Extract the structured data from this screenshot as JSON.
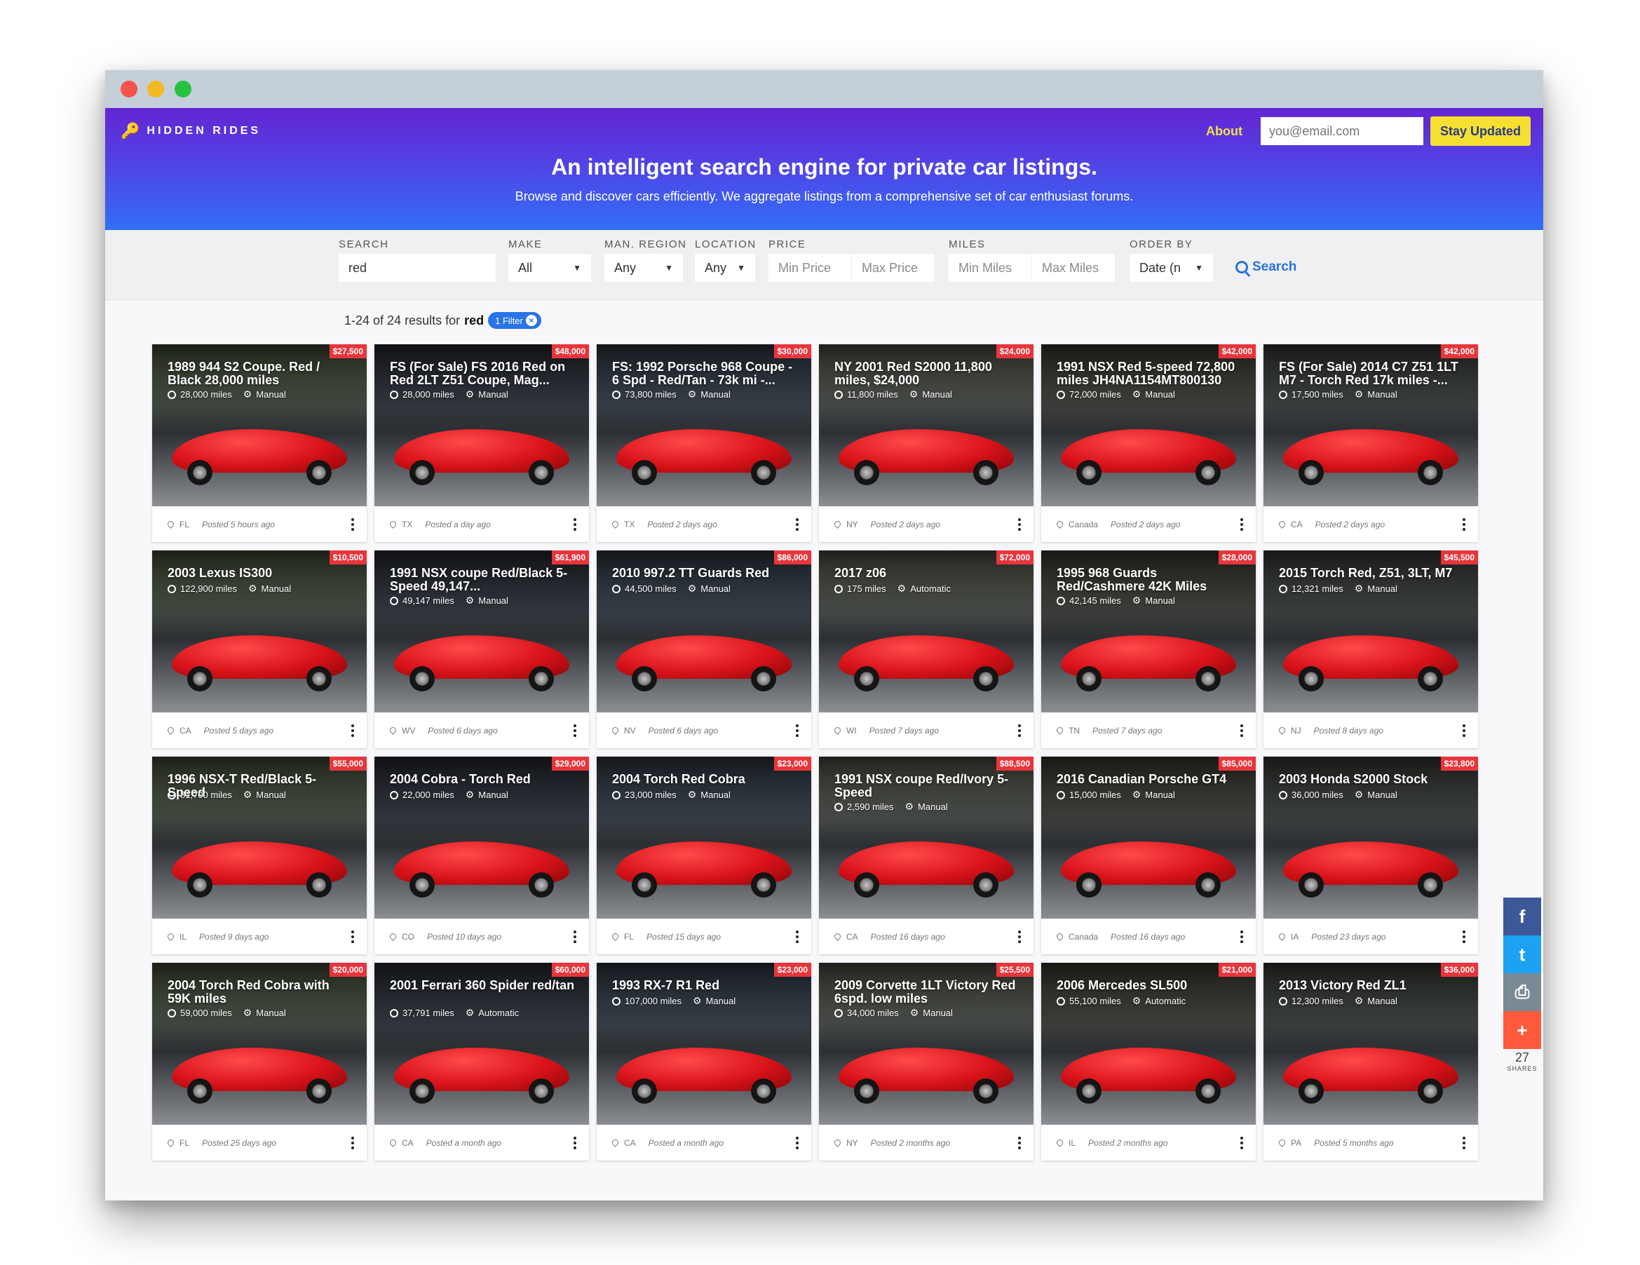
{
  "brand": {
    "name": "HIDDEN RIDES",
    "logo_icon": "key-icon"
  },
  "nav": {
    "about": "About",
    "email_placeholder": "you@email.com",
    "stay_updated": "Stay Updated"
  },
  "hero": {
    "title": "An intelligent search engine for private car listings.",
    "subtitle": "Browse and discover cars efficiently. We aggregate listings from a comprehensive set of car enthusiast forums."
  },
  "filters": {
    "search": {
      "label": "SEARCH",
      "value": "red"
    },
    "make": {
      "label": "MAKE",
      "value": "All"
    },
    "man_region": {
      "label": "MAN. REGION",
      "value": "Any"
    },
    "location": {
      "label": "LOCATION",
      "value": "Any"
    },
    "price": {
      "label": "PRICE",
      "min_placeholder": "Min Price",
      "max_placeholder": "Max Price"
    },
    "miles": {
      "label": "MILES",
      "min_placeholder": "Min Miles",
      "max_placeholder": "Max Miles"
    },
    "order_by": {
      "label": "ORDER BY",
      "value": "Date (n"
    },
    "search_button": "Search"
  },
  "results": {
    "prefix": "1-24 of 24 results for",
    "term": "red",
    "filter_pill": "1 Filter"
  },
  "listings": [
    {
      "title": "1989 944 S2 Coupe. Red / Black 28,000 miles",
      "price": "$27,500",
      "miles": "28,000 miles",
      "trans": "Manual",
      "loc": "FL",
      "posted": "Posted 5 hours ago"
    },
    {
      "title": "FS (For Sale) FS 2016 Red on Red 2LT Z51 Coupe, Mag...",
      "price": "$48,000",
      "miles": "28,000 miles",
      "trans": "Manual",
      "loc": "TX",
      "posted": "Posted a day ago"
    },
    {
      "title": "FS: 1992 Porsche 968 Coupe - 6 Spd - Red/Tan - 73k mi -...",
      "price": "$30,000",
      "miles": "73,800 miles",
      "trans": "Manual",
      "loc": "TX",
      "posted": "Posted 2 days ago"
    },
    {
      "title": "NY 2001 Red S2000 11,800 miles, $24,000",
      "price": "$24,000",
      "miles": "11,800 miles",
      "trans": "Manual",
      "loc": "NY",
      "posted": "Posted 2 days ago"
    },
    {
      "title": "1991 NSX Red 5-speed 72,800 miles JH4NA1154MT800130",
      "price": "$42,000",
      "miles": "72,000 miles",
      "trans": "Manual",
      "loc": "Canada",
      "posted": "Posted 2 days ago"
    },
    {
      "title": "FS (For Sale) 2014 C7 Z51 1LT M7 - Torch Red 17k miles -...",
      "price": "$42,000",
      "miles": "17,500 miles",
      "trans": "Manual",
      "loc": "CA",
      "posted": "Posted 2 days ago"
    },
    {
      "title": "2003 Lexus IS300",
      "price": "$10,500",
      "miles": "122,900 miles",
      "trans": "Manual",
      "loc": "CA",
      "posted": "Posted 5 days ago"
    },
    {
      "title": "1991 NSX coupe Red/Black 5-Speed 49,147...",
      "price": "$61,900",
      "miles": "49,147 miles",
      "trans": "Manual",
      "loc": "WV",
      "posted": "Posted 6 days ago"
    },
    {
      "title": "2010 997.2 TT Guards Red",
      "price": "$86,000",
      "miles": "44,500 miles",
      "trans": "Manual",
      "loc": "NV",
      "posted": "Posted 6 days ago"
    },
    {
      "title": "2017 z06",
      "price": "$72,000",
      "miles": "175 miles",
      "trans": "Automatic",
      "loc": "WI",
      "posted": "Posted 7 days ago"
    },
    {
      "title": "1995 968 Guards Red/Cashmere 42K Miles",
      "price": "$28,000",
      "miles": "42,145 miles",
      "trans": "Manual",
      "loc": "TN",
      "posted": "Posted 7 days ago"
    },
    {
      "title": "2015 Torch Red, Z51, 3LT, M7",
      "price": "$45,500",
      "miles": "12,321 miles",
      "trans": "Manual",
      "loc": "NJ",
      "posted": "Posted 8 days ago"
    },
    {
      "title": "1996 NSX-T Red/Black 5-Speed",
      "price": "$55,000",
      "miles": "81,700 miles",
      "trans": "Manual",
      "loc": "IL",
      "posted": "Posted 9 days ago"
    },
    {
      "title": "2004 Cobra - Torch Red",
      "price": "$29,000",
      "miles": "22,000 miles",
      "trans": "Manual",
      "loc": "CO",
      "posted": "Posted 10 days ago"
    },
    {
      "title": "2004 Torch Red Cobra",
      "price": "$23,000",
      "miles": "23,000 miles",
      "trans": "Manual",
      "loc": "FL",
      "posted": "Posted 15 days ago"
    },
    {
      "title": "1991 NSX coupe Red/Ivory 5-Speed",
      "price": "$88,500",
      "miles": "2,590 miles",
      "trans": "Manual",
      "loc": "CA",
      "posted": "Posted 16 days ago"
    },
    {
      "title": "2016 Canadian Porsche GT4",
      "price": "$85,000",
      "miles": "15,000 miles",
      "trans": "Manual",
      "loc": "Canada",
      "posted": "Posted 16 days ago"
    },
    {
      "title": "2003 Honda S2000 Stock",
      "price": "$23,800",
      "miles": "36,000 miles",
      "trans": "Manual",
      "loc": "IA",
      "posted": "Posted 23 days ago"
    },
    {
      "title": "2004 Torch Red Cobra with 59K miles",
      "price": "$20,000",
      "miles": "59,000 miles",
      "trans": "Manual",
      "loc": "FL",
      "posted": "Posted 25 days ago"
    },
    {
      "title": "2001 Ferrari 360 Spider red/tan",
      "price": "$60,000",
      "miles": "37,791 miles",
      "trans": "Automatic",
      "loc": "CA",
      "posted": "Posted a month ago"
    },
    {
      "title": "1993 RX-7 R1 Red",
      "price": "$23,000",
      "miles": "107,000 miles",
      "trans": "Manual",
      "loc": "CA",
      "posted": "Posted a month ago"
    },
    {
      "title": "2009 Corvette 1LT Victory Red 6spd. low miles",
      "price": "$25,500",
      "miles": "34,000 miles",
      "trans": "Manual",
      "loc": "NY",
      "posted": "Posted 2 months ago"
    },
    {
      "title": "2006 Mercedes SL500",
      "price": "$21,000",
      "miles": "55,100 miles",
      "trans": "Automatic",
      "loc": "IL",
      "posted": "Posted 2 months ago"
    },
    {
      "title": "2013 Victory Red ZL1",
      "price": "$36,000",
      "miles": "12,300 miles",
      "trans": "Manual",
      "loc": "PA",
      "posted": "Posted 5 months ago"
    }
  ],
  "share": {
    "count": "27",
    "label": "SHARES",
    "facebook": "f",
    "twitter": "t",
    "print": "⎙",
    "more": "+"
  },
  "colors": {
    "hero_top": "#6425d3",
    "hero_bottom": "#316ff8",
    "accent": "#f5e031",
    "price_badge": "#e8353c",
    "link_blue": "#2673e0"
  }
}
